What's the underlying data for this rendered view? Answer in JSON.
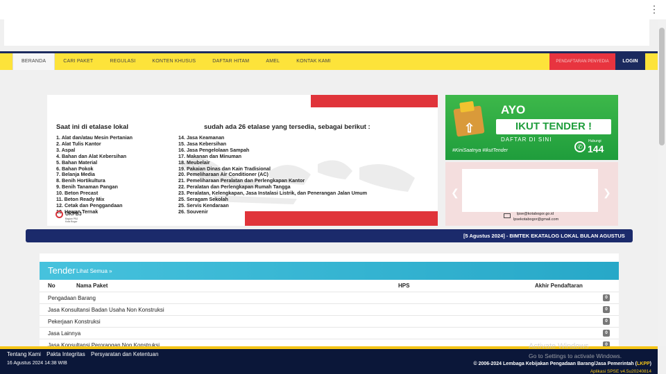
{
  "nav": {
    "items": [
      "BERANDA",
      "CARI PAKET",
      "REGULASI",
      "KONTEN KHUSUS",
      "DAFTAR HITAM",
      "AMEL",
      "KONTAK KAMI"
    ],
    "register": "PENDAFTARAN PENYEDIA",
    "login": "LOGIN"
  },
  "banner": {
    "heading": "Saat ini di etalase lokal",
    "heading2": "sudah ada 26 etalase yang tersedia, sebagai berikut :",
    "list1": [
      "1. Alat dan/atau Mesin Pertanian",
      "2. Alat Tulis Kantor",
      "3. Aspal",
      "4. Bahan dan Alat Kebersihan",
      "5. Bahan Material",
      "6. Bahan Pokok",
      "7. Belanja Media",
      "8. Benih Hortikultura",
      "9. Benih Tanaman Pangan",
      "10. Beton Precast",
      "11. Beton Ready Mix",
      "12. Cetak dan Penggandaan",
      "13. Hewan Ternak"
    ],
    "list2": [
      "14. Jasa Keamanan",
      "15. Jasa Kebersihan",
      "16. Jasa Pengelolaan Sampah",
      "17. Makanan dan Minuman",
      "18. Meubelair",
      "19. Pakaian Dinas dan Kain Tradisional",
      "20. Pemeliharaan Air Conditioner (AC)",
      "21. Pemeliharaan Peralatan dan Perlengkapan Kantor",
      "22. Peralatan dan Perlengkapan Rumah Tangga",
      "23. Peralatan, Kelengkapan, Jasa Instalasi Listrik, dan Penerangan Jalan Umum",
      "25. Seragam Sekolah",
      "25. Servis Kendaraan",
      "26. Souvenir"
    ],
    "logo": "UKPBJ",
    "logo_sub": "Bagian PBJ Kota Bogor"
  },
  "promo": {
    "ayo": "AYO",
    "ikut": "IKUT TENDER !",
    "daftar": "DAFTAR DI SINI",
    "tags": "#KiniSaatnya #IkutTender",
    "hubungi": "Hubungi",
    "number": "144"
  },
  "carousel": {
    "email1": "lpse@kotabogor.go.id",
    "email2": "lpsekotabogor@gmail.com"
  },
  "marquee": "[5 Agustus 2024] - BIMTEK EKATALOG LOKAL BULAN AGUSTUS",
  "tender": {
    "title": "Tender",
    "see_all": "Lihat Semua »",
    "columns": {
      "no": "No",
      "name": "Nama Paket",
      "hps": "HPS",
      "end": "Akhir Pendaftaran"
    },
    "rows": [
      {
        "name": "Pengadaan Barang",
        "count": "0"
      },
      {
        "name": "Jasa Konsultansi Badan Usaha Non Konstruksi",
        "count": "0"
      },
      {
        "name": "Pekerjaan Konstruksi",
        "count": "0"
      },
      {
        "name": "Jasa Lainnya",
        "count": "0"
      },
      {
        "name": "Jasa Konsultansi Perorangan Non Konstruksi",
        "count": "0"
      }
    ]
  },
  "footer": {
    "links": [
      "Tentang Kami",
      "Pakta Integritas",
      "Persyaratan dan Ketentuan"
    ],
    "date": "16 Agustus 2024 14:38 WIB",
    "copyright": "© 2006-2024 Lembaga Kebijakan Pengadaan Barang/Jasa Pemerintah (",
    "lkpp": "LKPP",
    "copyright_end": ")",
    "version": "Aplikasi SPSE v4.5u20240814"
  },
  "watermark": {
    "line1": "Activate Windows",
    "line2": "Go to Settings to activate Windows."
  }
}
